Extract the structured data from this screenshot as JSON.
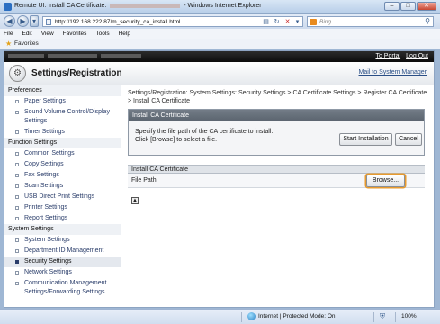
{
  "window": {
    "title_prefix": "Remote UI: Install CA Certificate:",
    "title_suffix": "- Windows Internet Explorer",
    "minimize": "–",
    "maximize": "□",
    "close": "✕"
  },
  "browser": {
    "url": "http://192.168.222.87/m_security_ca_install.html",
    "search_placeholder": "Bing",
    "menu": [
      "File",
      "Edit",
      "View",
      "Favorites",
      "Tools",
      "Help"
    ],
    "favorites_label": "Favorites"
  },
  "topbar": {
    "portal_link": "To Portal",
    "logout_link": "Log Out"
  },
  "header": {
    "title": "Settings/Registration",
    "mail_link": "Mail to System Manager"
  },
  "sidebar": {
    "preferences": {
      "label": "Preferences",
      "items": [
        "Paper Settings",
        "Sound Volume Control/Display Settings",
        "Timer Settings"
      ]
    },
    "function": {
      "label": "Function Settings",
      "items": [
        "Common Settings",
        "Copy Settings",
        "Fax Settings",
        "Scan Settings",
        "USB Direct Print Settings",
        "Printer Settings",
        "Report Settings"
      ]
    },
    "system": {
      "label": "System Settings",
      "items": [
        "System Settings",
        "Department ID Management",
        "Security Settings",
        "Network Settings",
        "Communication Management Settings/Forwarding Settings"
      ]
    }
  },
  "main": {
    "breadcrumb": "Settings/Registration: System Settings: Security Settings > CA Certificate Settings > Register CA Certificate > Install CA Certificate",
    "panel": {
      "title": "Install CA Certificate",
      "instruction_line1": "Specify the file path of the CA certificate to install.",
      "instruction_line2": "Click [Browse] to select a file.",
      "start_button": "Start Installation",
      "cancel_button": "Cancel"
    },
    "section": {
      "title": "Install CA Certificate",
      "file_path_label": "File Path:",
      "browse_button": "Browse..."
    }
  },
  "statusbar": {
    "zone": "Internet | Protected Mode: On",
    "zoom": "100%"
  }
}
